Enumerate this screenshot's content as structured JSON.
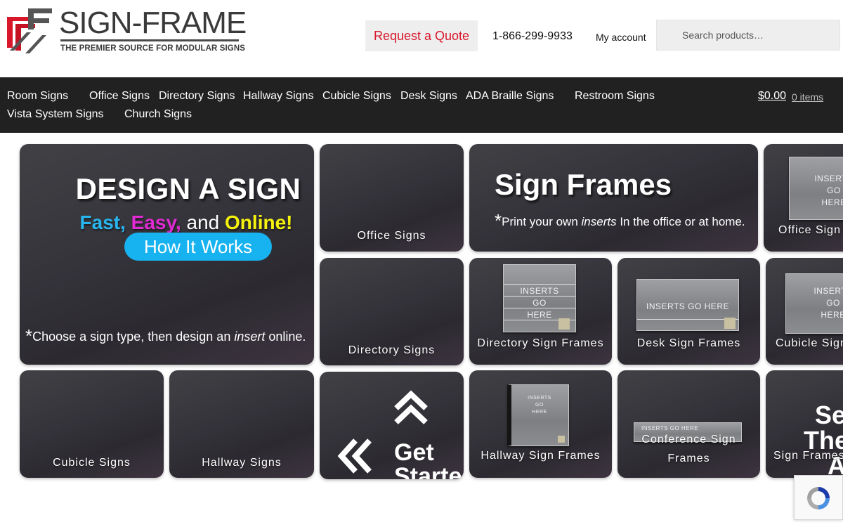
{
  "header": {
    "logo_word": "SIGN-FRAME",
    "logo_tagline": "THE PREMIER SOURCE FOR MODULAR SIGNS",
    "quote_label": "Request a Quote",
    "phone": "1-866-299-9933",
    "account_label": "My account",
    "search_placeholder": "Search products…"
  },
  "nav": {
    "items": [
      "Room Signs",
      "Office Signs",
      "Directory Signs",
      "Hallway Signs",
      "Cubicle Signs",
      "Desk Signs",
      "ADA Braille Signs",
      "Restroom Signs",
      "Vista System Signs",
      "Church Signs"
    ],
    "cart_total": "$0.00",
    "cart_count": "0 items"
  },
  "design": {
    "title": "DESIGN A SIGN",
    "fast": "Fast,",
    "easy": "Easy,",
    "and": "and",
    "online": "Online!",
    "button": "How It Works",
    "note_prefix": "Choose a sign type, then design an ",
    "note_em": "insert",
    "note_suffix": " online."
  },
  "frames": {
    "title": "Sign Frames",
    "note_prefix": "Print your own ",
    "note_em": "inserts",
    "note_suffix": " In the office or at home."
  },
  "tiles": {
    "office_signs": "Office Signs",
    "directory_signs": "Directory Signs",
    "cubicle_signs": "Cubicle Signs",
    "hallway_signs": "Hallway Signs",
    "get_started_line1": "Get",
    "get_started_line2": "Started!",
    "office_sign_frames": "Office Sign Frames",
    "directory_sign_frames": "Directory Sign Frames",
    "desk_sign_frames": "Desk Sign Frames",
    "cubicle_sign_frames": "Cubicle Sign Frames",
    "hallway_sign_frames": "Hallway Sign Frames",
    "conference_sign_frames_1": "Conference Sign",
    "conference_sign_frames_2": "Frames",
    "all_sign_frames": "Sign Frames",
    "see_them_all_1": "See",
    "see_them_all_2": "Them",
    "see_them_all_3": "All"
  },
  "sign_inserts": {
    "three_line": [
      "INSERTS",
      "GO",
      "HERE"
    ],
    "one_line": "INSERTS GO HERE",
    "tiny_lines": [
      "INSERTS",
      "GO",
      "HERE"
    ],
    "conference_tiny": "INSERTS GO HERE"
  },
  "icons": {
    "up": "chevron-up-icon",
    "left": "chevron-left-icon",
    "search": "search-icon",
    "recaptcha": "recaptcha-icon"
  },
  "colors": {
    "brand_red": "#d8172b",
    "nav_bg": "#212121",
    "fast": "#28b5ee",
    "easy": "#e12ad3",
    "online": "#f5f20e",
    "how_button": "#17b2f0"
  }
}
